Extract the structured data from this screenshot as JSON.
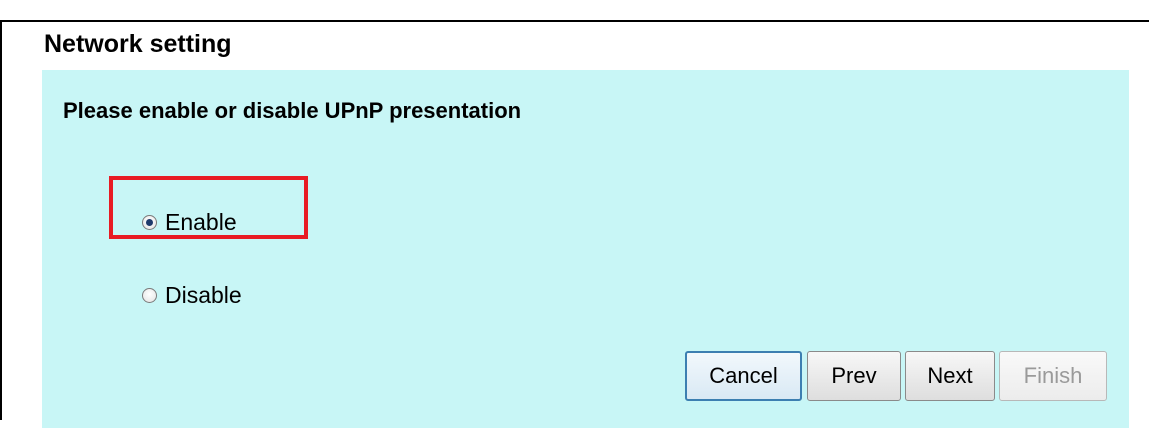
{
  "fieldset": {
    "legend": "Network setting"
  },
  "panel": {
    "heading": "Please enable or disable UPnP presentation",
    "options": [
      {
        "label": "Enable",
        "checked": true
      },
      {
        "label": "Disable",
        "checked": false
      }
    ]
  },
  "buttons": {
    "cancel": "Cancel",
    "prev": "Prev",
    "next": "Next",
    "finish": "Finish"
  },
  "colors": {
    "panel_bg": "#c8f6f6",
    "highlight": "#e81b23"
  }
}
